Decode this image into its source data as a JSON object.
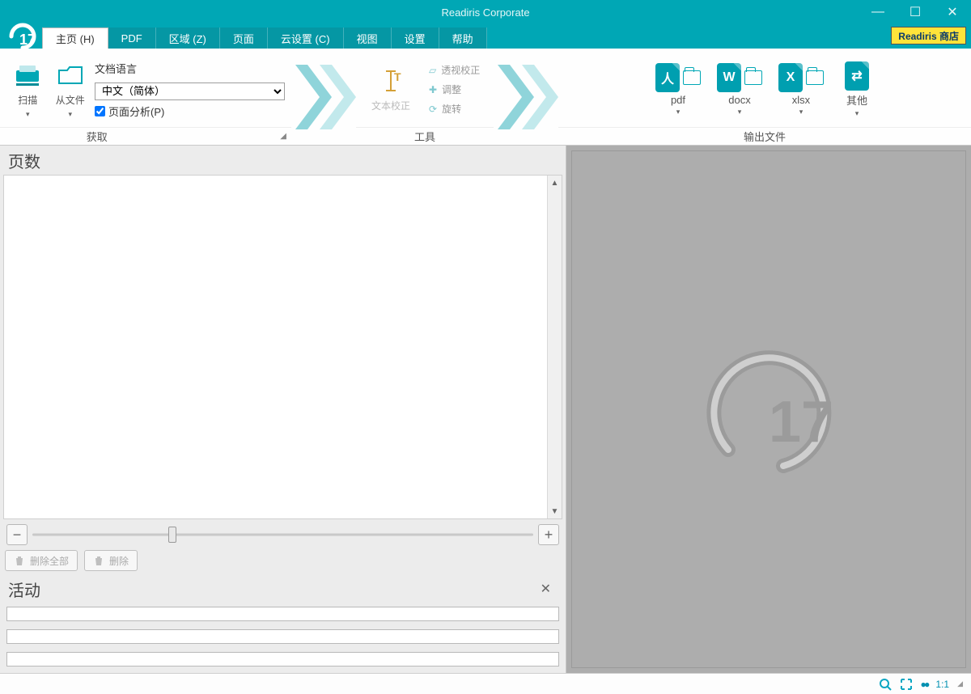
{
  "app": {
    "title": "Readiris Corporate",
    "logo_number": "17"
  },
  "window_controls": {
    "min": "—",
    "max": "☐",
    "close": "✕"
  },
  "tabs": [
    {
      "label": "主页 (H)",
      "active": true
    },
    {
      "label": "PDF"
    },
    {
      "label": "区域 (Z)"
    },
    {
      "label": "页面"
    },
    {
      "label": "云设置 (C)"
    },
    {
      "label": "视图"
    },
    {
      "label": "设置"
    },
    {
      "label": "帮助"
    }
  ],
  "store_button": "Readiris 商店",
  "ribbon": {
    "acquire": {
      "scan": "扫描",
      "from_file": "从文件",
      "lang_label": "文档语言",
      "lang_value": "中文（简体）",
      "page_analysis": "页面分析(P)",
      "group_label": "获取"
    },
    "tools": {
      "text_correction": "文本校正",
      "perspective": "透视校正",
      "adjust": "调整",
      "rotate": "旋转",
      "group_label": "工具"
    },
    "output": {
      "pdf": "pdf",
      "docx": "docx",
      "xlsx": "xlsx",
      "other": "其他",
      "group_label": "输出文件"
    }
  },
  "left_panel": {
    "pages_title": "页数",
    "delete_all": "删除全部",
    "delete": "删除",
    "activity_title": "活动"
  },
  "statusbar": {
    "zoom_ratio": "1:1"
  },
  "preview": {
    "watermark_number": "17"
  }
}
